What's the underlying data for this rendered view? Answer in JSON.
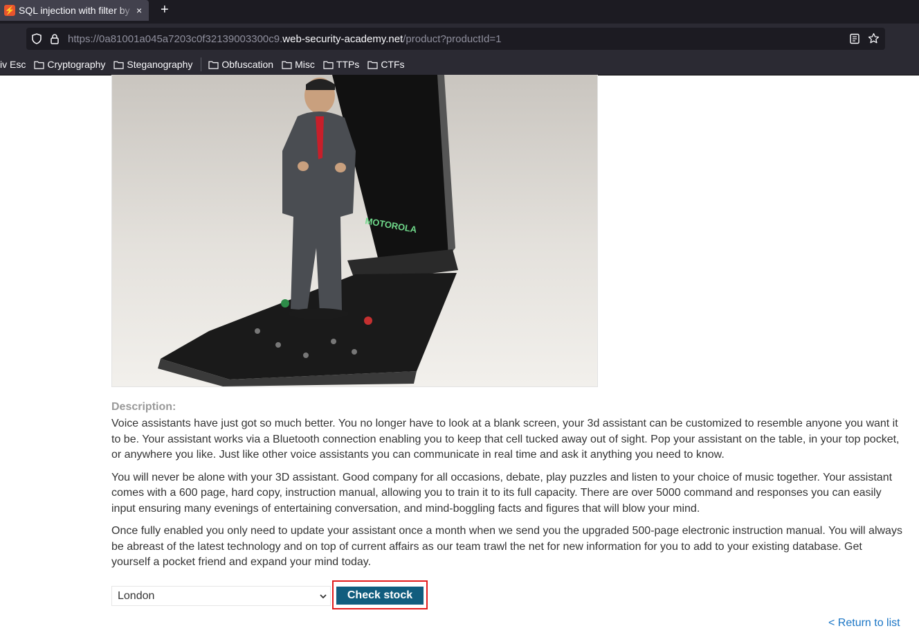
{
  "browser": {
    "tab": {
      "title": "SQL injection with filter by",
      "close": "×"
    },
    "new_tab": "+",
    "url": {
      "prefix": "https://0a81001a045a7203c0f32139003300c9.",
      "domain": "web-security-academy.net",
      "path": "/product?productId=1"
    },
    "bookmarks": [
      {
        "label": "iv Esc"
      },
      {
        "label": "Cryptography"
      },
      {
        "label": "Steganography"
      },
      {
        "label": "Obfuscation"
      },
      {
        "label": "Misc"
      },
      {
        "label": "TTPs"
      },
      {
        "label": "CTFs"
      }
    ]
  },
  "product": {
    "image_logo_text": "MOTOROLA",
    "description_heading": "Description:",
    "paragraphs": [
      "Voice assistants have just got so much better. You no longer have to look at a blank screen, your 3d assistant can be customized to resemble anyone you want it to be. Your assistant works via a Bluetooth connection enabling you to keep that cell tucked away out of sight. Pop your assistant on the table, in your top pocket, or anywhere you like. Just like other voice assistants you can communicate in real time and ask it anything you need to know.",
      "You will never be alone with your 3D assistant. Good company for all occasions, debate, play puzzles and listen to your choice of music together. Your assistant comes with a 600 page, hard copy, instruction manual, allowing you to train it to its full capacity. There are over 5000 command and responses you can easily input ensuring many evenings of entertaining conversation, and mind-boggling facts and figures that will blow your mind.",
      "Once fully enabled you only need to update your assistant once a month when we send you the upgraded 500-page electronic instruction manual. You will always be abreast of the latest technology and on top of current affairs as our team trawl the net for new information for you to add to your existing database. Get yourself a pocket friend and expand your mind today."
    ],
    "store_select": {
      "value": "London"
    },
    "check_stock_label": "Check stock",
    "return_link": "< Return to list"
  },
  "colors": {
    "button": "#115d7e",
    "highlight": "#e21a1a",
    "link": "#1a75c5"
  }
}
